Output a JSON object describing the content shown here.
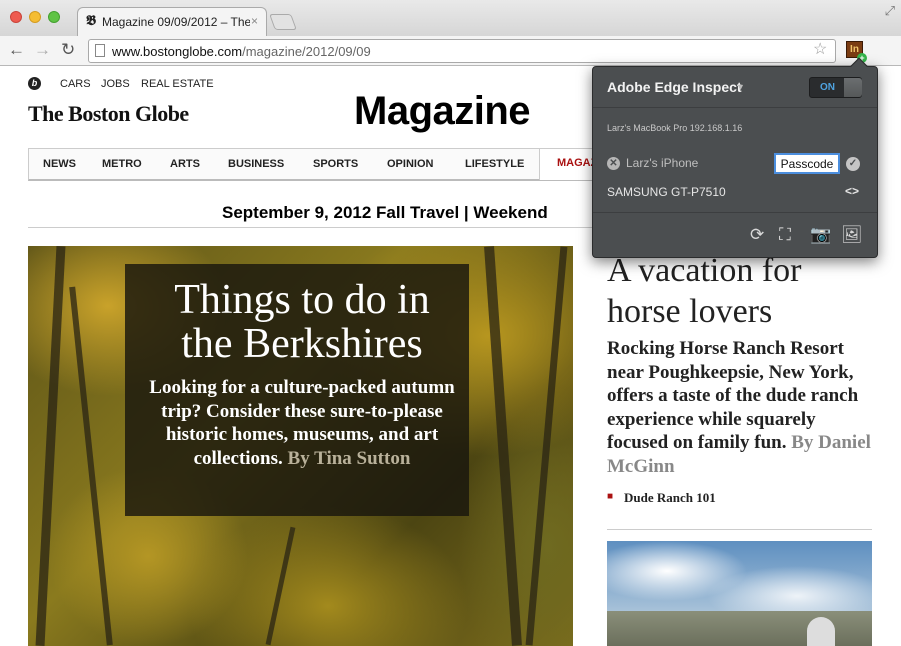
{
  "browser": {
    "tab_title": "Magazine 09/09/2012 – The",
    "tab_favicon": "𝕭",
    "tab_close": "×",
    "url_host": "www.bostonglobe.com",
    "url_path": "/magazine/2012/09/09",
    "icons": [
      "back-arrow-icon",
      "forward-arrow-icon",
      "reload-icon",
      "page-icon",
      "star-icon",
      "edge-inspect-extension-icon",
      "wrench-icon",
      "fullscreen-icon"
    ]
  },
  "site": {
    "logo_letter": "b",
    "top_links": [
      "CARS",
      "JOBS",
      "REAL ESTATE"
    ],
    "brand": "The Boston Globe",
    "section_title": "Magazine",
    "nav": [
      "NEWS",
      "METRO",
      "ARTS",
      "BUSINESS",
      "SPORTS",
      "OPINION",
      "LIFESTYLE"
    ],
    "nav_active": "MAGAZ",
    "issue_line": "September 9, 2012 Fall Travel | Weekend"
  },
  "hero": {
    "title": "Things to do in the Berkshires",
    "dek": "Looking for a culture-packed autumn trip? Consider these sure-to-please historic homes, museums, and art collections.",
    "byline": "By Tina Sutton"
  },
  "right_story": {
    "title": "A vacation for horse lovers",
    "dek": "Rocking Horse Ranch Resort near Poughkeepsie, New York, offers a taste of the dude ranch experience while squarely focused on family fun.",
    "byline": "By Daniel McGinn",
    "related_link": "Dude Ranch 101"
  },
  "edge_inspect": {
    "title": "Adobe Edge Inspect",
    "toggle": "ON",
    "host_info": "Larz's MacBook Pro  192.168.1.16",
    "devices": [
      {
        "name": "Larz's iPhone",
        "passcode_value": "Passcode"
      },
      {
        "name": "SAMSUNG GT-P7510",
        "code": "<>"
      }
    ],
    "tool_icons": [
      "refresh-icon",
      "fullscreen-icon",
      "camera-icon",
      "image-icon"
    ]
  },
  "colors": {
    "popup_bg": "#4b4e50",
    "toggle_on": "#4fa3e0",
    "nav_active": "#aa1111"
  }
}
